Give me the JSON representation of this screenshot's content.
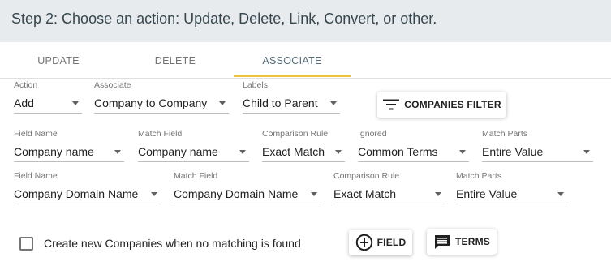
{
  "header": {
    "title": "Step 2: Choose an action: Update, Delete, Link, Convert, or other."
  },
  "tabs": [
    {
      "label": "UPDATE"
    },
    {
      "label": "DELETE"
    },
    {
      "label": "ASSOCIATE",
      "active": true
    }
  ],
  "colors": {
    "tab_indicator": "#f0c040",
    "header_bg": "#e8ebee",
    "active_tab": "#546e7a"
  },
  "row1": {
    "action": {
      "label": "Action",
      "value": "Add"
    },
    "associate": {
      "label": "Associate",
      "value": "Company to Company"
    },
    "labels": {
      "label": "Labels",
      "value": "Child to Parent"
    },
    "filter_button": {
      "icon": "filter-icon",
      "label": "COMPANIES FILTER"
    }
  },
  "row2": {
    "field_name": {
      "label": "Field Name",
      "value": "Company name"
    },
    "match_field": {
      "label": "Match Field",
      "value": "Company name"
    },
    "comparison_rule": {
      "label": "Comparison Rule",
      "value": "Exact Match"
    },
    "ignored": {
      "label": "Ignored",
      "value": "Common Terms"
    },
    "match_parts": {
      "label": "Match Parts",
      "value": "Entire Value"
    }
  },
  "row3": {
    "field_name": {
      "label": "Field Name",
      "value": "Company Domain Name"
    },
    "match_field": {
      "label": "Match Field",
      "value": "Company Domain Name"
    },
    "comparison_rule": {
      "label": "Comparison Rule",
      "value": "Exact Match"
    },
    "match_parts": {
      "label": "Match Parts",
      "value": "Entire Value"
    }
  },
  "footer": {
    "create_checkbox": {
      "label": "Create new Companies when no matching is found",
      "checked": false
    },
    "field_button": {
      "icon": "add-circle-icon",
      "label": "FIELD"
    },
    "terms_button": {
      "icon": "comment-icon",
      "label": "TERMS"
    }
  }
}
